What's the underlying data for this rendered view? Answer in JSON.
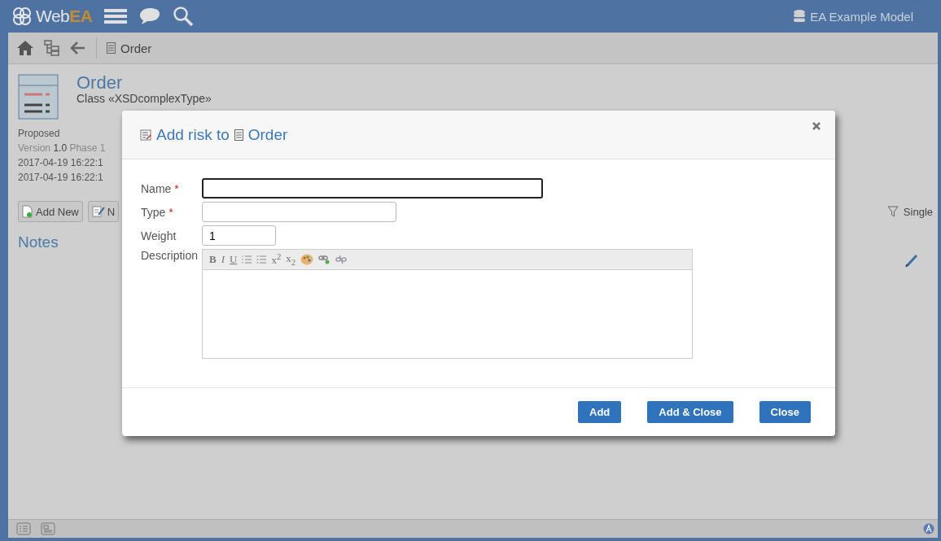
{
  "header": {
    "logo_left": "Web",
    "logo_right": "EA",
    "model": "EA Example Model"
  },
  "toolbar": {
    "crumb": "Order"
  },
  "element": {
    "name": "Order",
    "type": "Class «XSDcomplexType»",
    "status": "Proposed",
    "version_label": "Version",
    "version": "1.0",
    "phase": "Phase 1",
    "created": "2017-04-19 16:22:1",
    "modified": "2017-04-19 16:22:1"
  },
  "actions": [
    {
      "label": "Add New",
      "kind": "add"
    },
    {
      "label": "N",
      "kind": "note"
    }
  ],
  "filter": "Single",
  "section": "Notes",
  "dialog": {
    "title": "Add risk to",
    "target": "Order",
    "fields": [
      {
        "label": "Name",
        "marker": "*",
        "focused": true
      },
      {
        "label": "Type",
        "marker": "*",
        "focused": false
      },
      {
        "label": "Weight",
        "focused": false,
        "value": "1"
      }
    ],
    "description_label": "Description",
    "editor_tools": [
      {
        "kind": "bold",
        "label": "B"
      },
      {
        "kind": "italic",
        "label": "I"
      },
      {
        "kind": "underline",
        "label": "U"
      },
      {
        "kind": "ordered-list"
      },
      {
        "kind": "bullet-list"
      },
      {
        "kind": "superscript",
        "label": "x$^{2}$"
      },
      {
        "kind": "subscript",
        "label": "x$_{2}$"
      },
      {
        "kind": "palette"
      },
      {
        "kind": "link"
      },
      {
        "kind": "unlink"
      }
    ],
    "buttons": [
      "Add",
      "Add & Close",
      "Close"
    ]
  }
}
